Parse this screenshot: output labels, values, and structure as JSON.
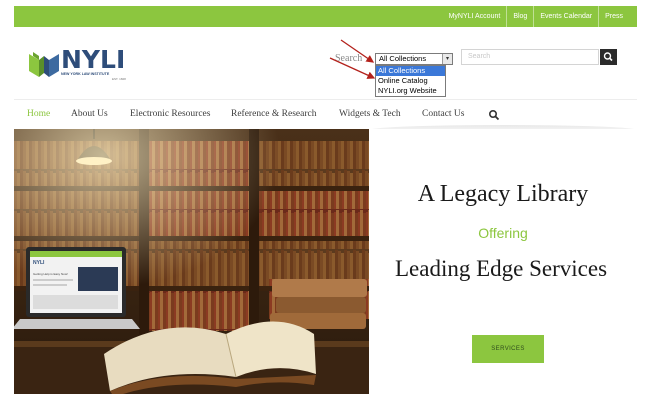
{
  "topbar": {
    "links": [
      "MyNYLI Account",
      "Blog",
      "Events Calendar",
      "Press"
    ]
  },
  "logo": {
    "name": "NYLI",
    "subtitle": "NEW YORK LAW INSTITUTE",
    "est": "EST. 1828"
  },
  "search": {
    "label": "Search",
    "select_value": "All Collections",
    "options": [
      "All Collections",
      "Online Catalog",
      "NYLI.org Website"
    ],
    "highlighted_option": "All Collections",
    "input_placeholder": "Search"
  },
  "nav": {
    "items": [
      "Home",
      "About Us",
      "Electronic Resources",
      "Reference & Research",
      "Widgets & Tech",
      "Contact Us"
    ],
    "active": "Home"
  },
  "hero": {
    "line1": "A Legacy Library",
    "line2": "Offering",
    "line3": "Leading Edge Services",
    "button_label": "SERVICES"
  },
  "laptop_screen": {
    "brand": "NYLI",
    "heading": "Getting Help is Easy Now!"
  },
  "colors": {
    "accent": "#8cc63f",
    "brand_blue": "#2e4d7a",
    "annotation_arrow": "#b3211b",
    "highlight": "#3b78d8"
  }
}
